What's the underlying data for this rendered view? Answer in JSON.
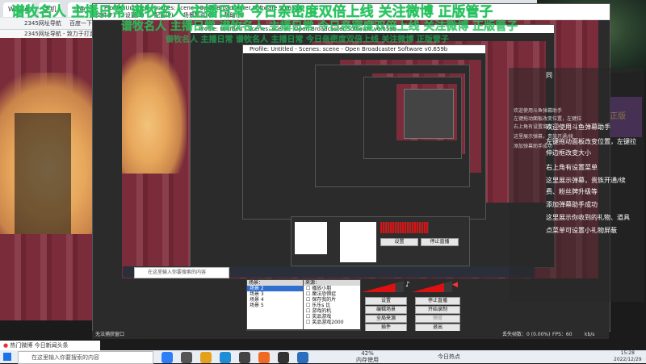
{
  "browser": {
    "tabs": [
      "Windo",
      "手机",
      "斗鱼",
      "名称"
    ],
    "address_items": [
      "2345网址导航 - 致力于打造百"
    ],
    "bookmarks": [
      "2345网址导航",
      "百度一下",
      "手机上网导航",
      "今日热点"
    ]
  },
  "obs": {
    "title": "Profile: Untitled - Scenes: scene - Open Broadcaster Software v0.659b",
    "menu": [
      "文件(F)",
      "设置(S)",
      "配置(P)",
      "场景集合(C)",
      "帮助(H)"
    ],
    "scenes_header": "场景：",
    "scenes": [
      "场景 2",
      "场景 3",
      "场景 4",
      "场景 5"
    ],
    "sources_header": "来源：",
    "sources": [
      "播放小朋",
      "魔法恐惧症",
      "保存我的片",
      "乐乐s 比",
      "游戏的机",
      "奖品游戏",
      "奖品游戏2000",
      "警示面比2000",
      "游戏播放器"
    ],
    "buttons": {
      "settings": "设置",
      "stop_stream": "停止直播",
      "edit_scene": "编辑场景",
      "start_record": "开始录制",
      "global_sources": "全局来源",
      "preview": "预览",
      "plugins": "插件",
      "exit": "退出"
    },
    "meter_percent": 80,
    "status": {
      "left": "无法捕获窗口",
      "dropped": "丢失帧数：0 (0.00%)",
      "fps": "FPS：60",
      "bitrate": "kb/s"
    }
  },
  "overlay": {
    "green_text": "谱牧名人 主播日常 谱牧名人 主播日常 今日亲密度双倍上线 关注微博 正版管子"
  },
  "helper": {
    "title": "同",
    "lines": [
      "欢迎使用斗鱼弹幕助手",
      "左键拖动面板改变位置，左键拉",
      "伸边框改变大小",
      "右上角有设置菜单",
      "这里展示弹幕，贵族开通/续",
      "费、粉丝牌升级等",
      "添加弹幕助手成功",
      "这里展示你收到的礼物、道具",
      "点菜单可设置小礼物屏蔽"
    ]
  },
  "poster": {
    "label": "正版"
  },
  "notification": {
    "badge": "热门微博",
    "text": "今日新闻头条"
  },
  "taskbar": {
    "search_placeholder": "在这里输入你要搜索的内容",
    "cpu_percent": "42%",
    "cpu_label": "内存使用",
    "news": "今日热点",
    "time": "15:28",
    "date": "2022/12/29"
  },
  "colors": {
    "accent_green": "#29c45d",
    "meter_red": "#dd1111",
    "selection_blue": "#2f6fd0"
  }
}
